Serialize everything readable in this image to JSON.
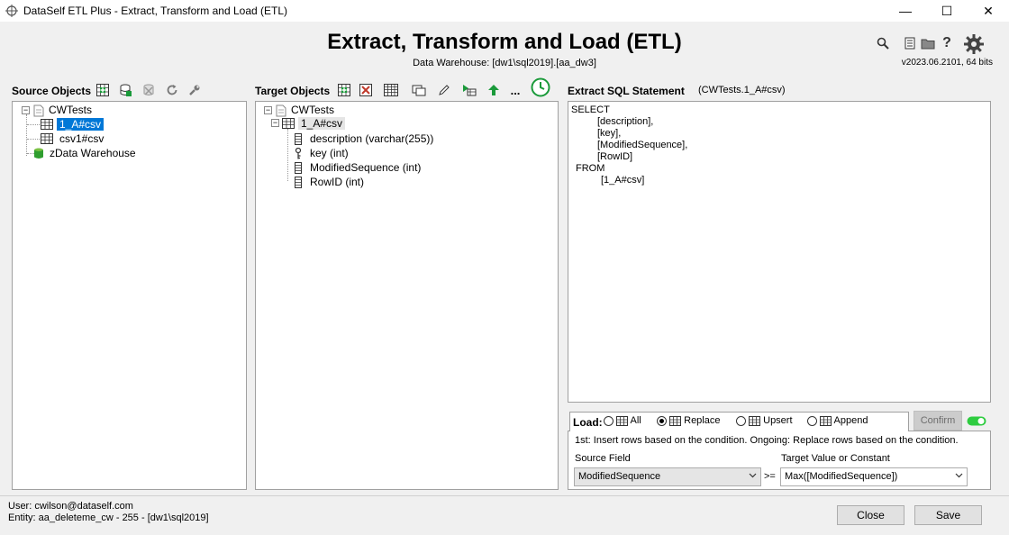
{
  "window": {
    "title": "DataSelf ETL Plus - Extract, Transform and Load (ETL)",
    "minimize": "—",
    "maximize": "☐",
    "close": "✕"
  },
  "header": {
    "title": "Extract, Transform and Load (ETL)",
    "subtitle": "Data Warehouse: [dw1\\sql2019].[aa_dw3]",
    "version": "v2023.06.2101, 64 bits",
    "icons": [
      "search-icon",
      "document-icon",
      "folder-icon",
      "help-icon",
      "gear-icon"
    ],
    "help_label": "?"
  },
  "source": {
    "label": "Source Objects",
    "tree": {
      "root": "CWTests",
      "children": [
        "1_A#csv",
        "csv1#csv"
      ],
      "warehouse": "zData Warehouse"
    }
  },
  "target": {
    "label": "Target Objects",
    "more": "...",
    "tree": {
      "root": "CWTests",
      "table": "1_A#csv",
      "columns": [
        "description (varchar(255))",
        "key (int)",
        "ModifiedSequence (int)",
        "RowID (int)"
      ]
    }
  },
  "sql": {
    "label": "Extract SQL Statement",
    "object": "(CWTests.1_A#csv)",
    "lines": [
      "SELECT",
      "[description],",
      "[key],",
      "[ModifiedSequence],",
      "[RowID]",
      "FROM",
      "[1_A#csv]"
    ]
  },
  "load": {
    "label": "Load:",
    "options": [
      "All",
      "Replace",
      "Upsert",
      "Append"
    ],
    "selected": "Replace",
    "confirm": "Confirm",
    "description": "1st: Insert rows based on the condition. Ongoing: Replace rows based on the condition.",
    "source_field_label": "Source Field",
    "source_field_value": "ModifiedSequence",
    "operator": ">=",
    "target_label": "Target Value or Constant",
    "target_value": "Max([ModifiedSequence])"
  },
  "footer": {
    "user": "User:  cwilson@dataself.com",
    "entity": "Entity: aa_deleteme_cw - 255 -  [dw1\\sql2019]",
    "close": "Close",
    "save": "Save"
  },
  "colors": {
    "selection": "#0078d7",
    "toggle_on": "#2ecc40",
    "green_icon": "#1a9a3a",
    "red_icon": "#c0392b"
  }
}
